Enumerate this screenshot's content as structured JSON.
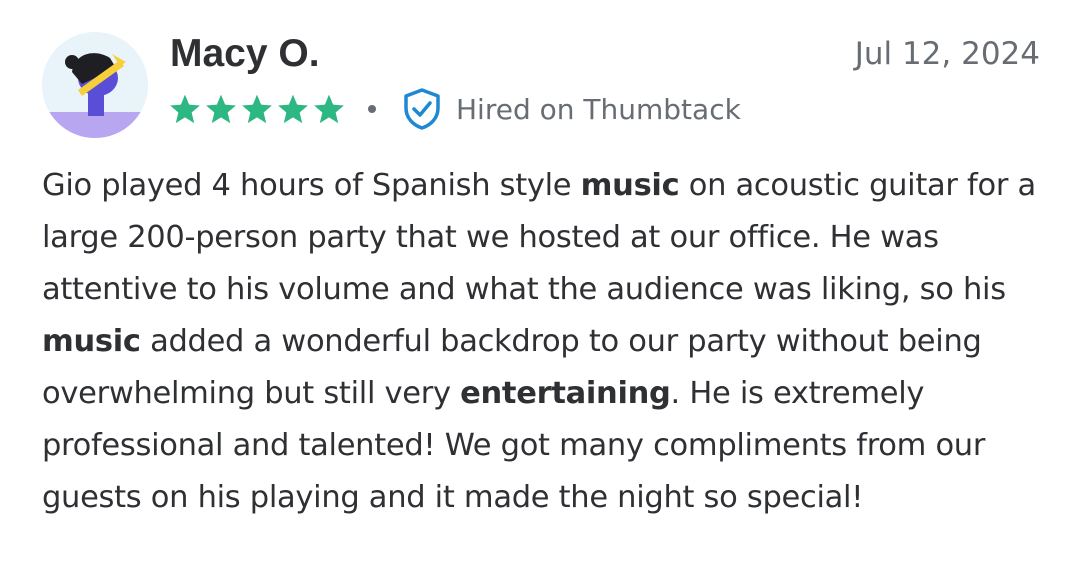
{
  "review": {
    "reviewer_name": "Macy O.",
    "date": "Jul 12, 2024",
    "rating": 5,
    "rating_max": 5,
    "star_color": "#2db783",
    "hired_label": "Hired on Thumbtack",
    "verified_icon": "shield-check-icon",
    "verified_icon_color": "#1e88d2",
    "avatar_icon": "person-with-cap-avatar",
    "text_segments": [
      {
        "text": "Gio played 4 hours of Spanish style ",
        "bold": false
      },
      {
        "text": "music",
        "bold": true
      },
      {
        "text": " on acoustic guitar for a large 200-person party that we hosted at our office. He was attentive to his volume and what the audience was liking, so his ",
        "bold": false
      },
      {
        "text": "music",
        "bold": true
      },
      {
        "text": " added a wonderful backdrop to our party without being overwhelming but still very ",
        "bold": false
      },
      {
        "text": "entertaining",
        "bold": true
      },
      {
        "text": ". He is extremely professional and talented! We got many compliments from our guests on his playing and it made the night so special!",
        "bold": false
      }
    ]
  }
}
